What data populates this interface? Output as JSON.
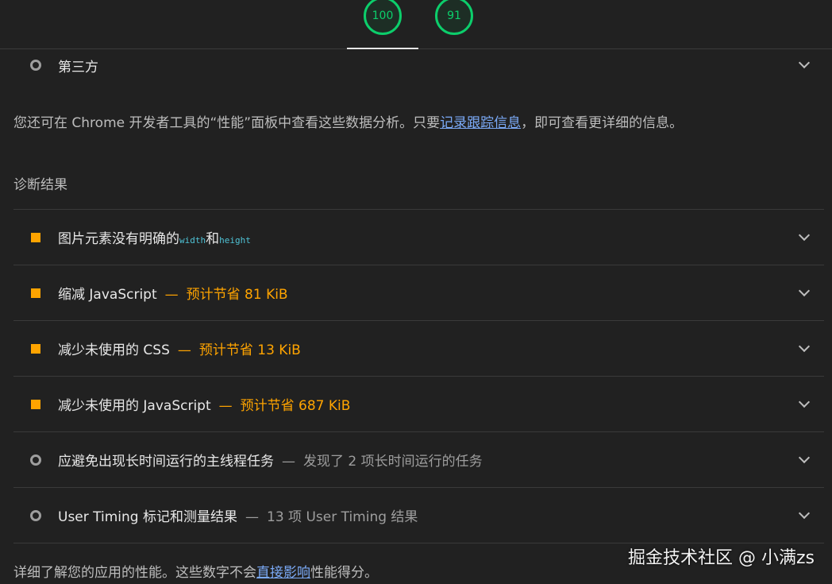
{
  "scores": [
    {
      "value": "100",
      "color": "#0cce6b"
    },
    {
      "value": "91",
      "color": "#0cce6b"
    }
  ],
  "third_party": {
    "title": "第三方"
  },
  "intro": {
    "prefix": "您还可在 Chrome 开发者工具的“性能”面板中查看这些数据分析。只要",
    "link": "记录跟踪信息",
    "suffix": "，即可查看更详细的信息。"
  },
  "diagnostics": {
    "section_title": "诊断结果",
    "items": [
      {
        "title_a": "图片元素没有明确的",
        "code_a": "width",
        "title_b": "和",
        "code_b": "height",
        "marker": "square-warning"
      },
      {
        "title": "缩减 JavaScript",
        "sep": "—",
        "savings": "预计节省 81 KiB",
        "marker": "square-warning"
      },
      {
        "title": "减少未使用的 CSS",
        "sep": "—",
        "savings": "预计节省 13 KiB",
        "marker": "square-warning"
      },
      {
        "title": "减少未使用的 JavaScript",
        "sep": "—",
        "savings": "预计节省 687 KiB",
        "marker": "square-warning"
      },
      {
        "title": "应避免出现长时间运行的主线程任务",
        "sep": "—",
        "info": "发现了 2 项长时间运行的任务",
        "marker": "circle-info"
      },
      {
        "title": "User Timing 标记和测量结果",
        "sep": "—",
        "info": "13 项 User Timing 结果",
        "marker": "circle-info"
      }
    ]
  },
  "footer": {
    "prefix": "详细了解您的应用的性能。这些数字不会",
    "link": "直接影响",
    "suffix": "性能得分。"
  },
  "watermark": "掘金技术社区 @ 小满zs",
  "colors": {
    "background": "#212121",
    "pass": "#0cce6b",
    "warning": "#ffa400",
    "link": "#7baaf7"
  }
}
